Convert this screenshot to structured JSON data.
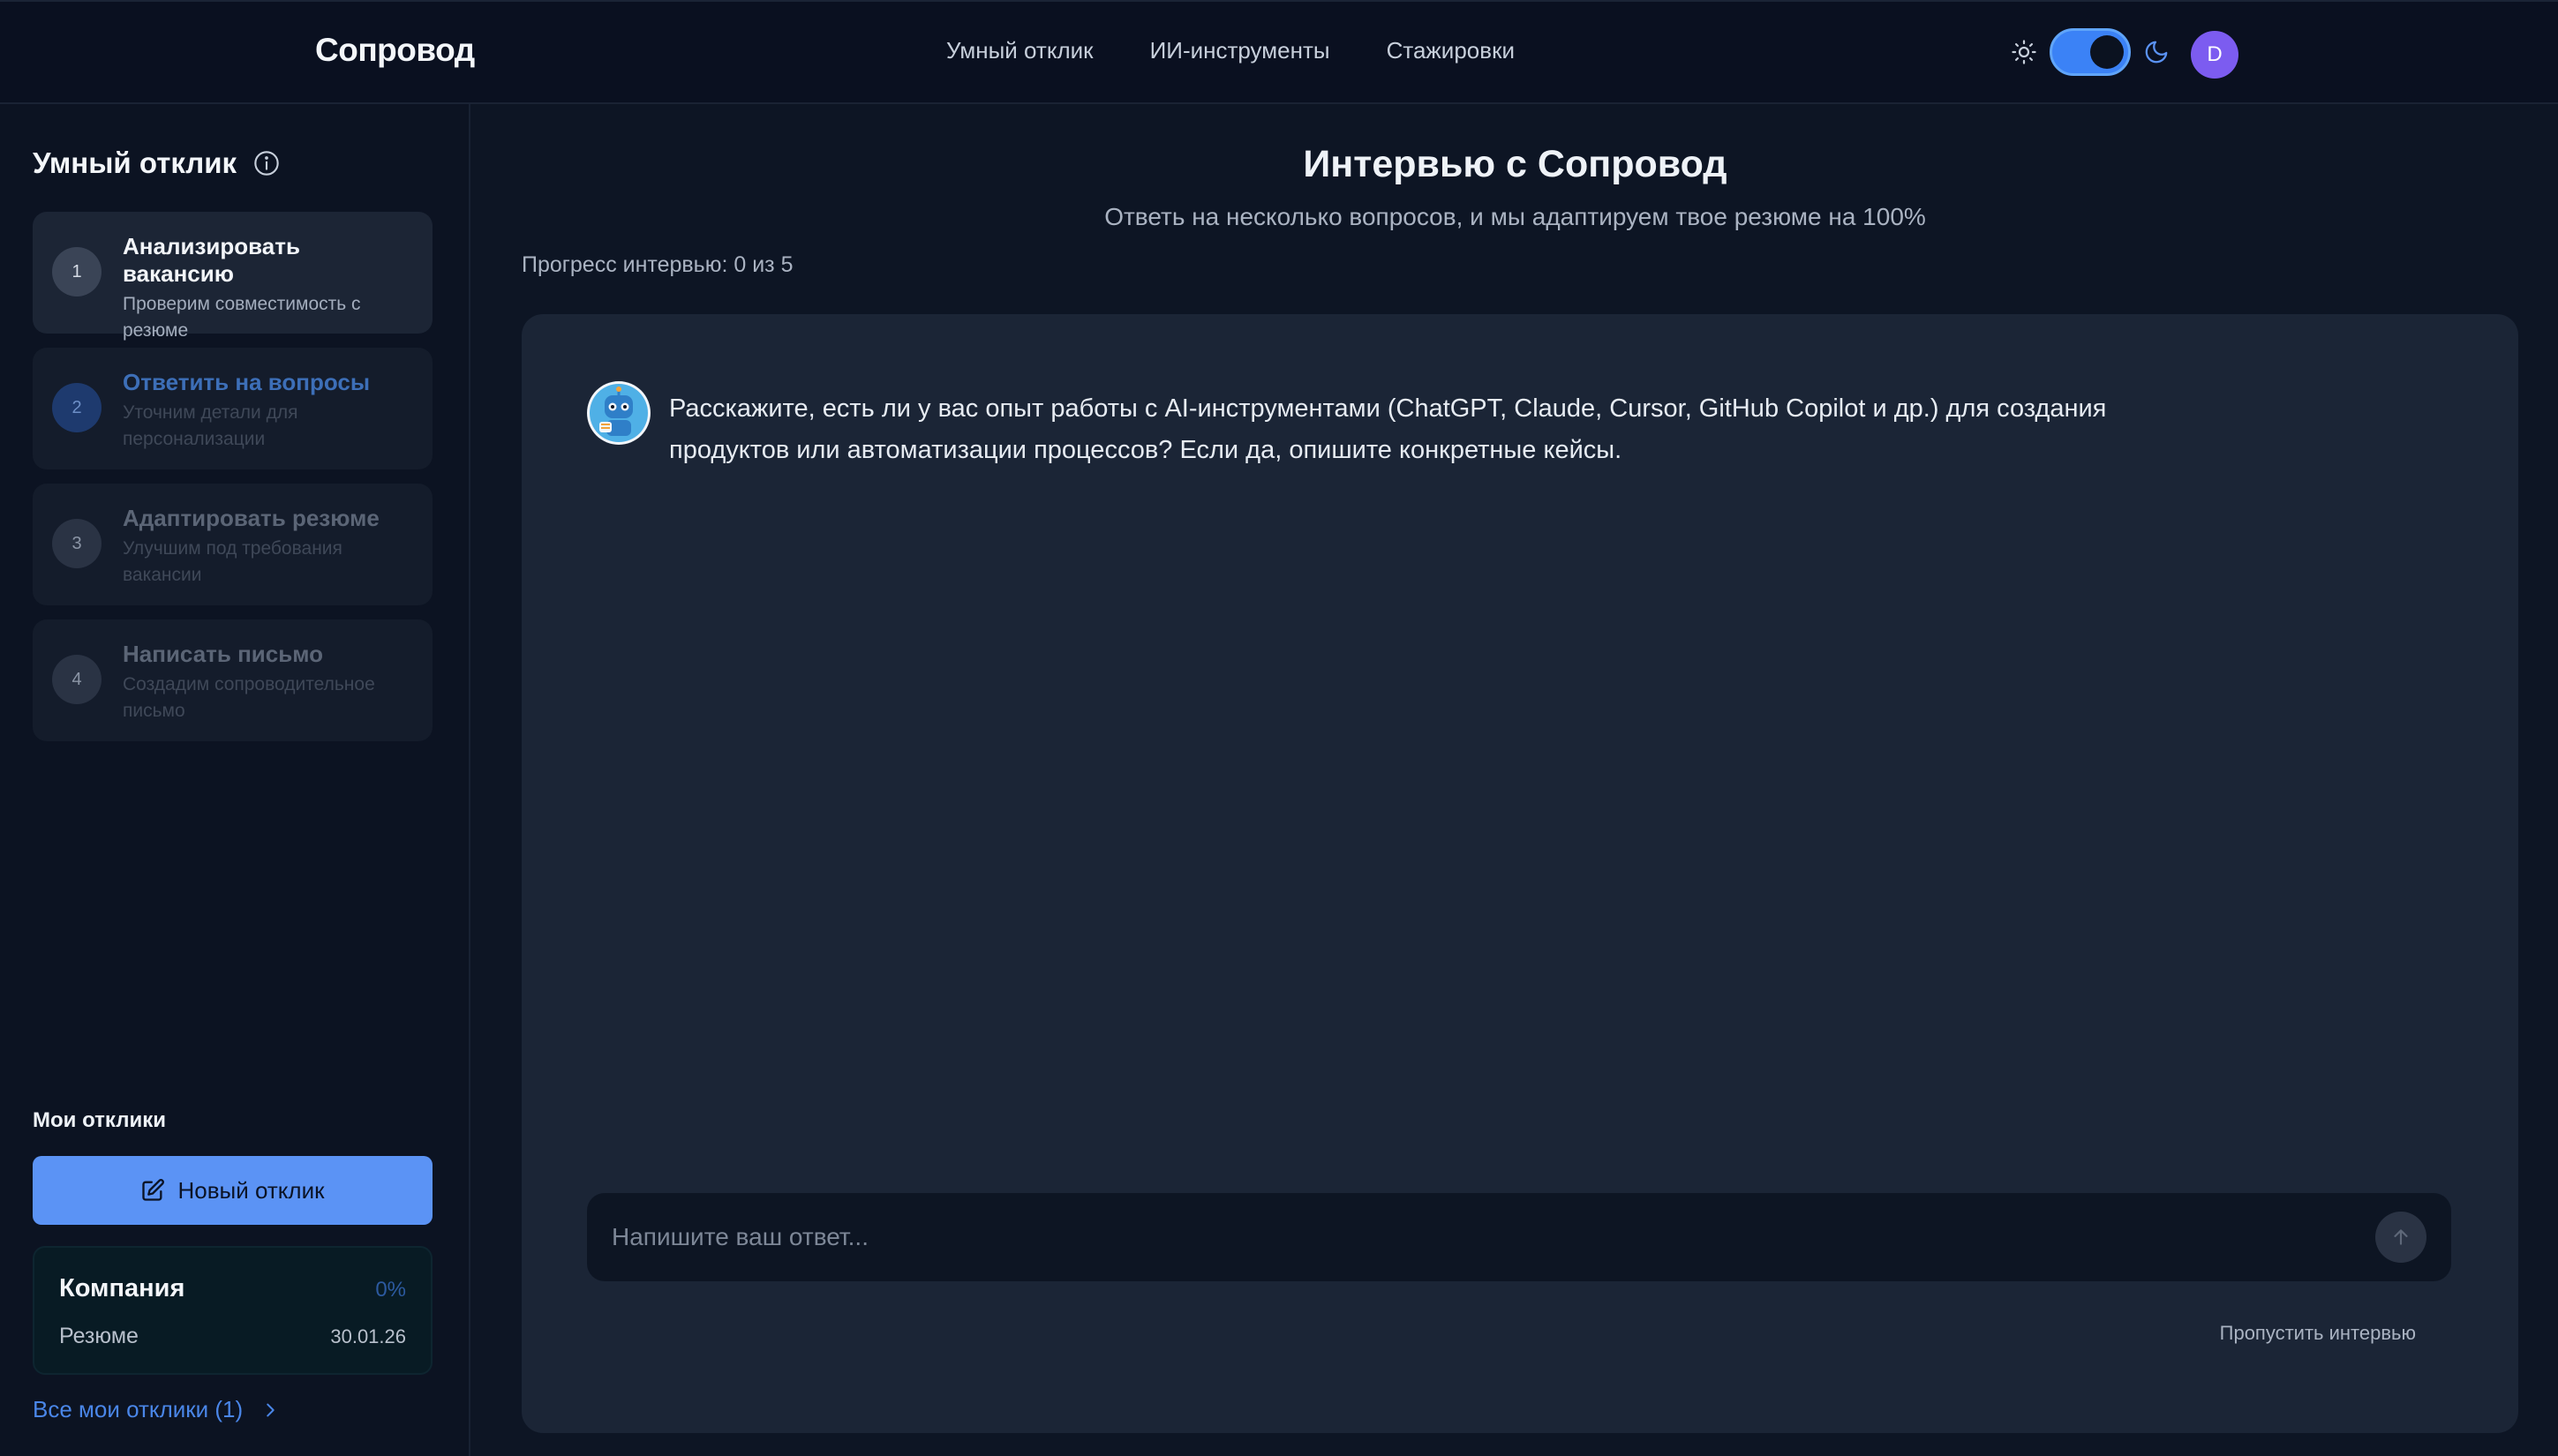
{
  "header": {
    "logo": "Сопровод",
    "nav": [
      "Умный отклик",
      "ИИ-инструменты",
      "Стажировки"
    ],
    "theme_toggle": {
      "state": "dark",
      "icons": [
        "sun-icon",
        "moon-icon"
      ]
    },
    "avatar_initial": "D"
  },
  "sidebar": {
    "title": "Умный отклик",
    "steps": [
      {
        "num": "1",
        "title": "Анализировать вакансию",
        "desc": "Проверим совместимость с резюме",
        "state": "completed"
      },
      {
        "num": "2",
        "title": "Ответить на вопросы",
        "desc": "Уточним детали для персонализации",
        "state": "current"
      },
      {
        "num": "3",
        "title": "Адаптировать резюме",
        "desc": "Улучшим под требования вакансии",
        "state": "pending"
      },
      {
        "num": "4",
        "title": "Написать письмо",
        "desc": "Создадим сопроводительное письмо",
        "state": "pending"
      }
    ],
    "my_responses_title": "Мои отклики",
    "new_button": "Новый отклик",
    "card": {
      "company": "Компания",
      "percent": "0%",
      "resume": "Резюме",
      "date": "30.01.26"
    },
    "all_link": "Все мои отклики (1)"
  },
  "main": {
    "title": "Интервью с Сопровод",
    "subtitle": "Ответь на несколько вопросов, и мы адаптируем твое резюме на 100%",
    "progress": "Прогресс интервью: 0 из 5",
    "question": "Расскажите, есть ли у вас опыт работы с AI-инструментами (ChatGPT, Claude, Cursor, GitHub Copilot и др.) для создания продуктов или автоматизации процессов? Если да, опишите конкретные кейсы.",
    "input_placeholder": "Напишите ваш ответ...",
    "skip": "Пропустить интервью"
  },
  "colors": {
    "accent": "#5b93f5",
    "avatar": "#7c5cf0",
    "background": "#0d1524"
  }
}
